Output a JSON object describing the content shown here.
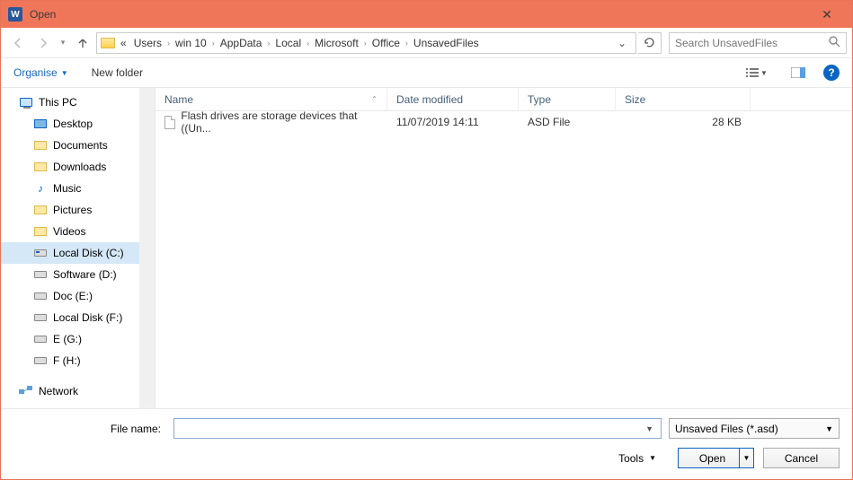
{
  "titlebar": {
    "title": "Open"
  },
  "breadcrumb": [
    "Users",
    "win 10",
    "AppData",
    "Local",
    "Microsoft",
    "Office",
    "UnsavedFiles"
  ],
  "search": {
    "placeholder": "Search UnsavedFiles"
  },
  "toolbar": {
    "organise": "Organise",
    "newfolder": "New folder"
  },
  "columns": {
    "name": "Name",
    "date": "Date modified",
    "type": "Type",
    "size": "Size"
  },
  "files": [
    {
      "name": "Flash drives are storage devices that ((Un...",
      "date": "11/07/2019 14:11",
      "type": "ASD File",
      "size": "28 KB"
    }
  ],
  "sidebar": {
    "root": "This PC",
    "items": [
      {
        "label": "Desktop",
        "icon": "desktop"
      },
      {
        "label": "Documents",
        "icon": "folder"
      },
      {
        "label": "Downloads",
        "icon": "folder"
      },
      {
        "label": "Music",
        "icon": "music"
      },
      {
        "label": "Pictures",
        "icon": "folder"
      },
      {
        "label": "Videos",
        "icon": "folder"
      },
      {
        "label": "Local Disk (C:)",
        "icon": "drive-c",
        "selected": true
      },
      {
        "label": "Software (D:)",
        "icon": "drive"
      },
      {
        "label": "Doc (E:)",
        "icon": "drive"
      },
      {
        "label": "Local Disk (F:)",
        "icon": "drive"
      },
      {
        "label": "E (G:)",
        "icon": "drive"
      },
      {
        "label": "F (H:)",
        "icon": "drive"
      }
    ],
    "network": "Network"
  },
  "footer": {
    "filename_label": "File name:",
    "filename_value": "",
    "filter": "Unsaved Files (*.asd)",
    "tools": "Tools",
    "open": "Open",
    "cancel": "Cancel"
  }
}
